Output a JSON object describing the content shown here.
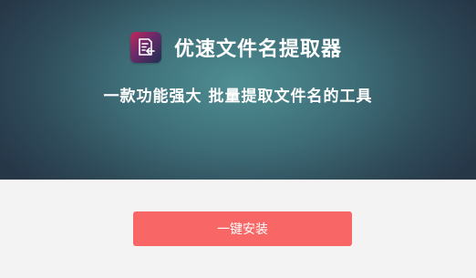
{
  "header": {
    "app_title": "优速文件名提取器",
    "subtitle": "一款功能强大 批量提取文件名的工具",
    "logo_icon": "document-arrow-left-icon"
  },
  "actions": {
    "install_label": "一键安装"
  },
  "colors": {
    "accent_button": "#f86666",
    "hero_center": "#4e8e92",
    "hero_edge": "#263748",
    "page_background": "#f4f3f4"
  }
}
